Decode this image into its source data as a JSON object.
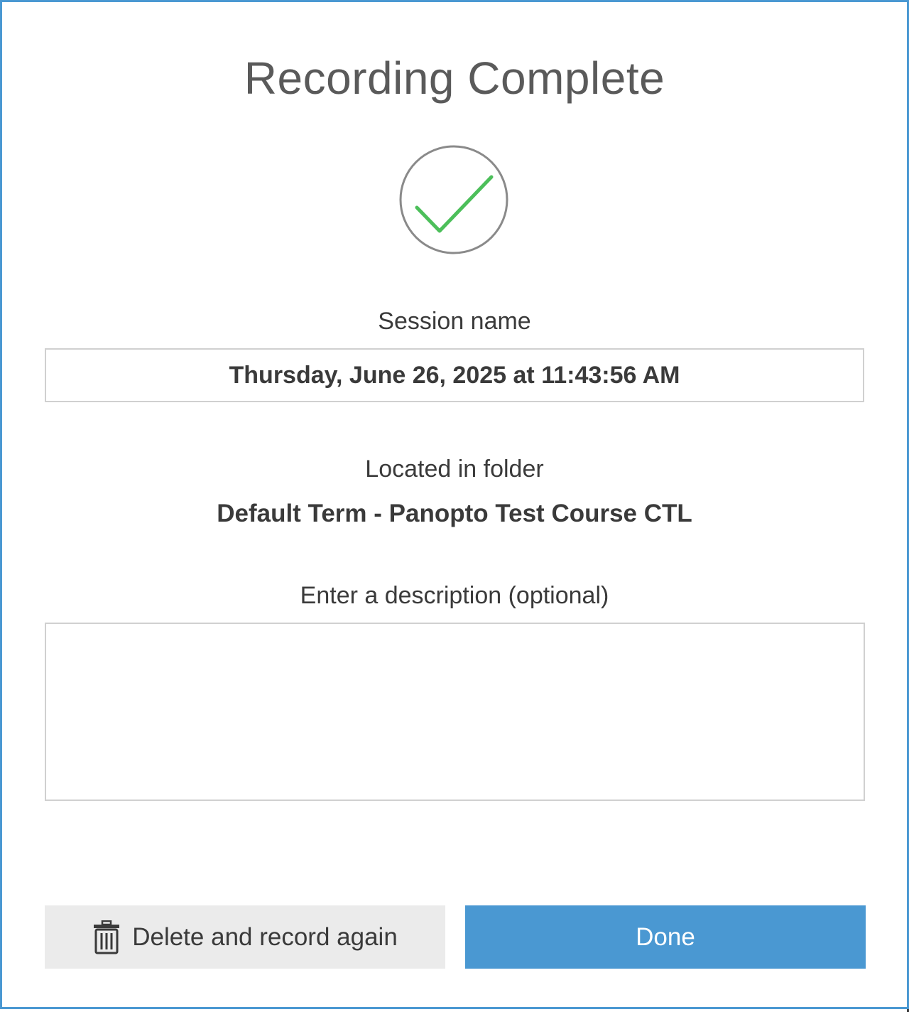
{
  "dialog": {
    "title": "Recording Complete",
    "status_icon": "checkmark-circle-icon",
    "accent_color": "#4a98d2",
    "check_color": "#4cbf5a"
  },
  "session": {
    "label": "Session name",
    "value": "Thursday, June 26, 2025 at 11:43:56 AM"
  },
  "folder": {
    "label": "Located in folder",
    "value": "Default Term - Panopto Test Course CTL"
  },
  "description": {
    "label": "Enter a description (optional)",
    "value": ""
  },
  "actions": {
    "delete_label": "Delete and record again",
    "delete_icon": "trash-icon",
    "done_label": "Done"
  }
}
